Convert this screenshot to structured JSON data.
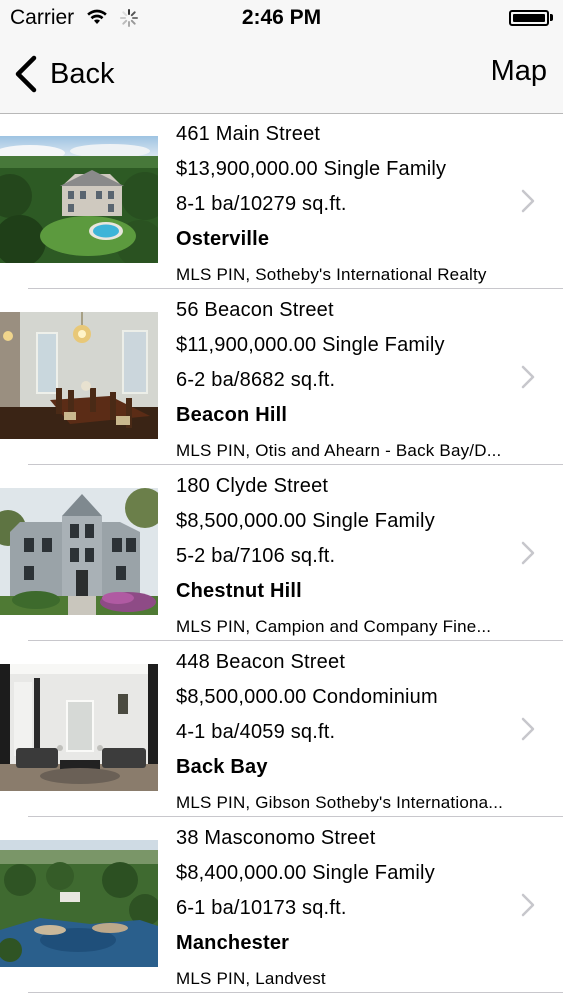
{
  "status_bar": {
    "carrier": "Carrier",
    "time": "2:46 PM",
    "wifi_icon": "wifi-icon",
    "activity_icon": "activity-spinner-icon",
    "battery_icon": "battery-icon",
    "battery_level": 1.0
  },
  "nav": {
    "back_label": "Back",
    "map_label": "Map",
    "back_icon": "chevron-left-icon"
  },
  "listings": [
    {
      "address": "461 Main Street",
      "price_type": "$13,900,000.00 Single Family",
      "details": "8-1 ba/10279 sq.ft.",
      "neighborhood": "Osterville",
      "agency": "MLS PIN, Sotheby's International Realty",
      "photo": "estate-aerial-photo"
    },
    {
      "address": "56 Beacon Street",
      "price_type": "$11,900,000.00 Single Family",
      "details": "6-2 ba/8682 sq.ft.",
      "neighborhood": "Beacon Hill",
      "agency": "MLS PIN, Otis and Ahearn - Back Bay/D...",
      "photo": "dining-room-photo"
    },
    {
      "address": "180 Clyde Street",
      "price_type": "$8,500,000.00 Single Family",
      "details": "5-2 ba/7106 sq.ft.",
      "neighborhood": "Chestnut Hill",
      "agency": "MLS PIN, Campion and Company Fine...",
      "photo": "house-facade-photo"
    },
    {
      "address": "448 Beacon Street",
      "price_type": "$8,500,000.00 Condominium",
      "details": "4-1 ba/4059 sq.ft.",
      "neighborhood": "Back Bay",
      "agency": "MLS PIN, Gibson Sotheby's Internationa...",
      "photo": "living-room-photo"
    },
    {
      "address": "38 Masconomo Street",
      "price_type": "$8,400,000.00 Single Family",
      "details": "6-1 ba/10173 sq.ft.",
      "neighborhood": "Manchester",
      "agency": "MLS PIN, Landvest",
      "photo": "coastal-aerial-photo"
    }
  ],
  "row_chevron_icon": "chevron-right-icon"
}
